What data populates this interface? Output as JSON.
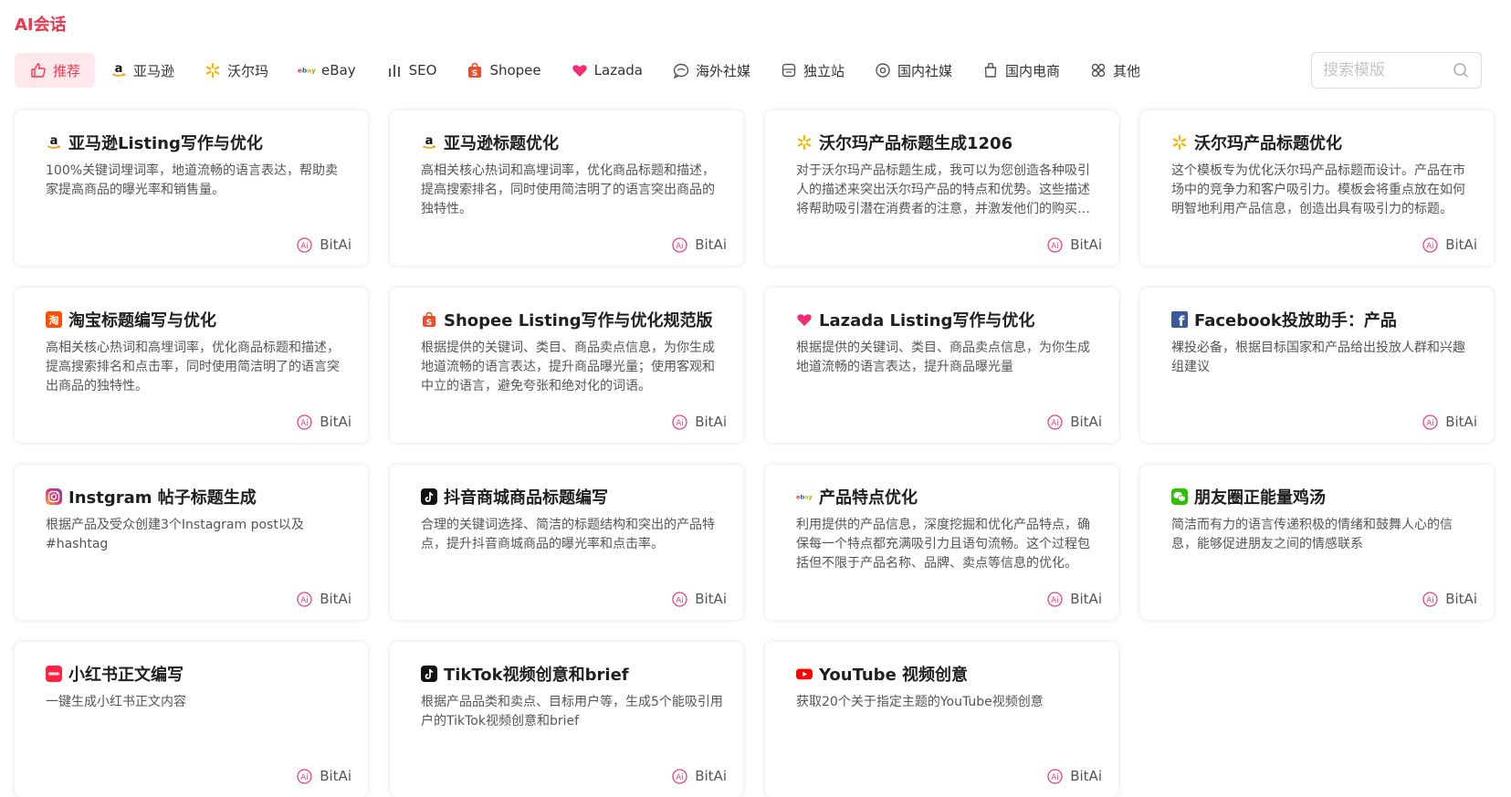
{
  "page_title": "AI会话",
  "tabs": [
    {
      "label": "推荐",
      "icon": "thumbs-up-icon",
      "active": true
    },
    {
      "label": "亚马逊",
      "icon": "amazon-icon"
    },
    {
      "label": "沃尔玛",
      "icon": "walmart-icon"
    },
    {
      "label": "eBay",
      "icon": "ebay-icon"
    },
    {
      "label": "SEO",
      "icon": "bar-chart-icon"
    },
    {
      "label": "Shopee",
      "icon": "shopee-icon"
    },
    {
      "label": "Lazada",
      "icon": "lazada-icon"
    },
    {
      "label": "海外社媒",
      "icon": "globe-chat-icon"
    },
    {
      "label": "独立站",
      "icon": "storefront-icon"
    },
    {
      "label": "国内社媒",
      "icon": "circle-chat-icon"
    },
    {
      "label": "国内电商",
      "icon": "shopping-bag-icon"
    },
    {
      "label": "其他",
      "icon": "grid-icon"
    }
  ],
  "search": {
    "placeholder": "搜索模版"
  },
  "colors": {
    "accent": "#f0344f",
    "active_tab_bg": "#fde8ec",
    "bitai": "#e8417a"
  },
  "cards": [
    {
      "title": "亚马逊Listing写作与优化",
      "icon": "amazon-icon",
      "desc": "100%关键词埋词率，地道流畅的语言表达，帮助卖家提高商品的曝光率和销售量。",
      "author": "BitAi"
    },
    {
      "title": "亚马逊标题优化",
      "icon": "amazon-icon",
      "desc": "高相关核心热词和高埋词率，优化商品标题和描述，提高搜索排名，同时使用简洁明了的语言突出商品的独特性。",
      "author": "BitAi"
    },
    {
      "title": "沃尔玛产品标题生成1206",
      "icon": "walmart-icon",
      "desc": "对于沃尔玛产品标题生成，我可以为您创造各种吸引人的描述来突出沃尔玛产品的特点和优势。这些描述将帮助吸引潜在消费者的注意，并激发他们的购买欲望。",
      "author": "BitAi"
    },
    {
      "title": "沃尔玛产品标题优化",
      "icon": "walmart-icon",
      "desc": "这个模板专为优化沃尔玛产品标题而设计。产品在市场中的竞争力和客户吸引力。模板会将重点放在如何明智地利用产品信息，创造出具有吸引力的标题。",
      "author": "BitAi"
    },
    {
      "title": "淘宝标题编写与优化",
      "icon": "taobao-icon",
      "desc": "高相关核心热词和高埋词率，优化商品标题和描述，提高搜索排名和点击率，同时使用简洁明了的语言突出商品的独特性。",
      "author": "BitAi"
    },
    {
      "title": "Shopee Listing写作与优化规范版",
      "icon": "shopee-icon",
      "desc": "根据提供的关键词、类目、商品卖点信息，为你生成地道流畅的语言表达，提升商品曝光量；使用客观和中立的语言，避免夸张和绝对化的词语。",
      "author": "BitAi"
    },
    {
      "title": "Lazada Listing写作与优化",
      "icon": "lazada-icon",
      "desc": "根据提供的关键词、类目、商品卖点信息，为你生成地道流畅的语言表达，提升商品曝光量",
      "author": "BitAi"
    },
    {
      "title": "Facebook投放助手：产品",
      "icon": "facebook-icon",
      "desc": "裸投必备，根据目标国家和产品给出投放人群和兴趣组建议",
      "author": "BitAi"
    },
    {
      "title": "Instgram 帖子标题生成",
      "icon": "instagram-icon",
      "desc": "根据产品及受众创建3个Instagram post以及#hashtag",
      "author": "BitAi"
    },
    {
      "title": "抖音商城商品标题编写",
      "icon": "douyin-icon",
      "desc": "合理的关键词选择、简洁的标题结构和突出的产品特点，提升抖音商城商品的曝光率和点击率。",
      "author": "BitAi"
    },
    {
      "title": "产品特点优化",
      "icon": "ebay-icon",
      "desc": "利用提供的产品信息，深度挖掘和优化产品特点，确保每一个特点都充满吸引力且语句流畅。这个过程包括但不限于产品名称、品牌、卖点等信息的优化。",
      "author": "BitAi"
    },
    {
      "title": "朋友圈正能量鸡汤",
      "icon": "wechat-icon",
      "desc": "简洁而有力的语言传递积极的情绪和鼓舞人心的信息，能够促进朋友之间的情感联系",
      "author": "BitAi"
    },
    {
      "title": "小红书正文编写",
      "icon": "xiaohongshu-icon",
      "desc": "一键生成小红书正文内容",
      "author": "BitAi"
    },
    {
      "title": "TikTok视频创意和brief",
      "icon": "douyin-icon",
      "desc": "根据产品品类和卖点、目标用户等，生成5个能吸引用户的TikTok视频创意和brief",
      "author": "BitAi"
    },
    {
      "title": "YouTube 视频创意",
      "icon": "youtube-icon",
      "desc": "获取20个关于指定主题的YouTube视频创意",
      "author": "BitAi"
    }
  ]
}
